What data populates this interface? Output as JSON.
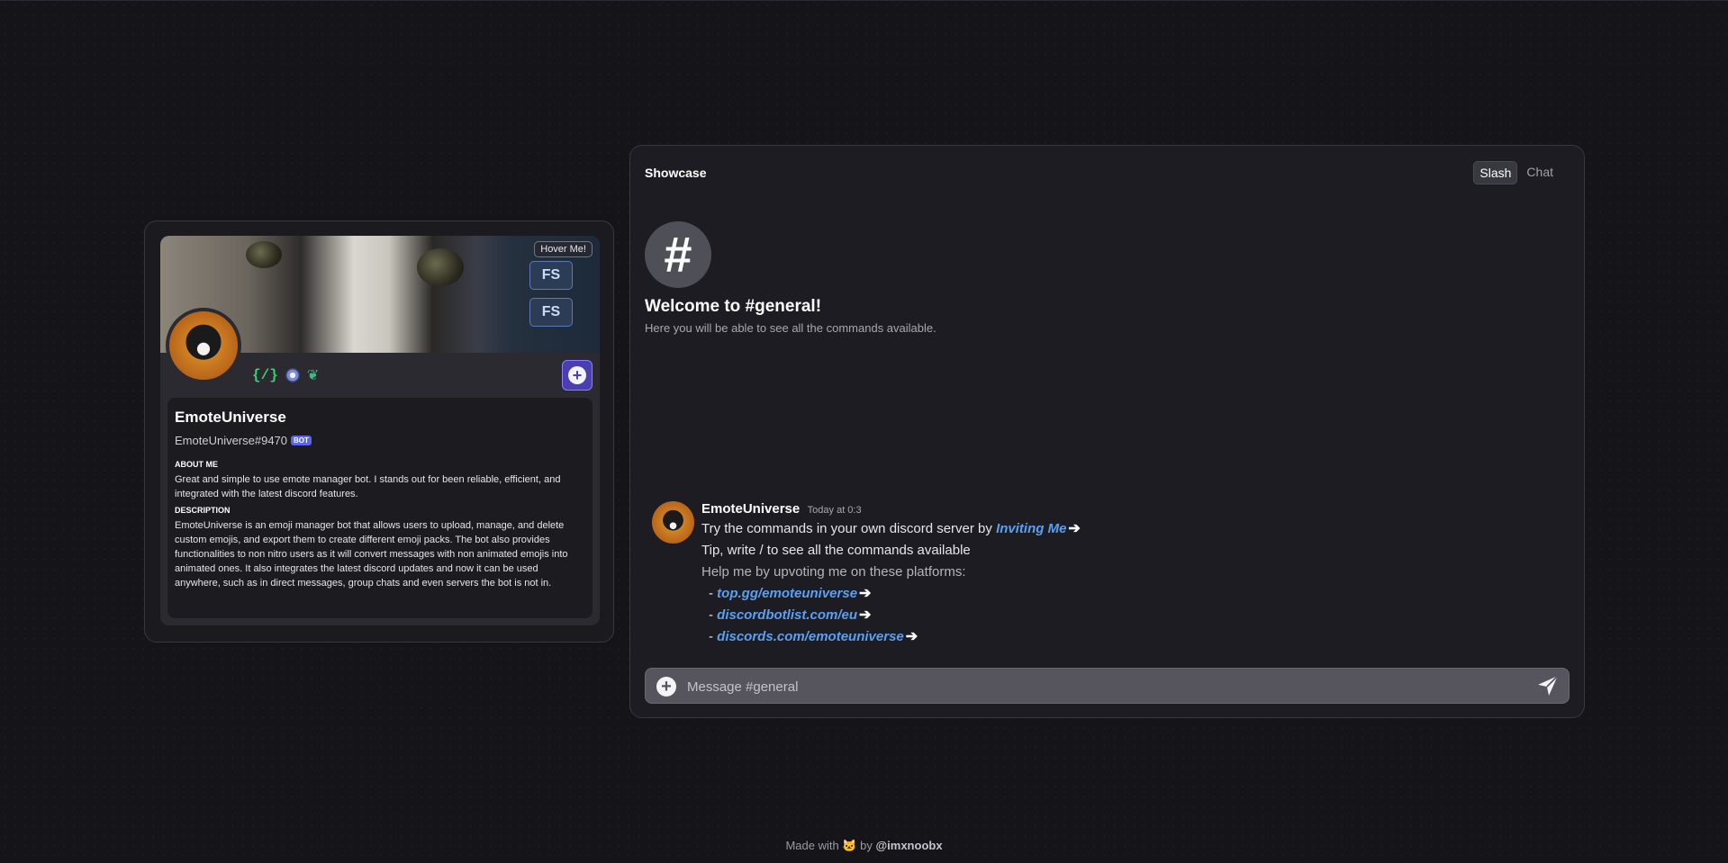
{
  "profile": {
    "hover_badge": "Hover Me!",
    "banner_keys": [
      "FS",
      "FS"
    ],
    "name": "EmoteUniverse",
    "tag": "EmoteUniverse#9470",
    "bot_label": "BOT",
    "badges": {
      "slash": "{/}"
    },
    "add_label": "+",
    "about_title": "ABOUT ME",
    "about_text": "Great and simple to use emote manager bot. I stands out for been reliable, efficient, and integrated with the latest discord features.",
    "description_title": "DESCRIPTION",
    "description_text": "EmoteUniverse is an emoji manager bot that allows users to upload, manage, and delete custom emojis, and export them to create different emoji packs. The bot also provides functionalities to non nitro users as it will convert messages with non animated emojis into animated ones. It also integrates the latest discord updates and now it can be used anywhere, such as in direct messages, group chats and even servers the bot is not in."
  },
  "showcase": {
    "title": "Showcase",
    "tabs": [
      {
        "label": "Slash",
        "active": true
      },
      {
        "label": "Chat",
        "active": false
      }
    ],
    "hash_symbol": "#",
    "welcome_title": "Welcome to #general!",
    "welcome_sub": "Here you will be able to see all the commands available.",
    "message": {
      "author": "EmoteUniverse",
      "time": "Today at 0:3",
      "line1_prefix": "Try the commands in your own discord server by",
      "line1_link": "Inviting Me",
      "line2": "Tip, write / to see all the commands available",
      "line3": "Help me by upvoting me on these platforms:",
      "bullet_prefix": "-",
      "platforms": [
        "top.gg/emoteuniverse",
        "discordbotlist.com/eu",
        "discords.com/emoteuniverse"
      ],
      "arrow": "➔"
    },
    "composer": {
      "add_label": "+",
      "placeholder": "Message #general"
    }
  },
  "footer": {
    "made_with": "Made with",
    "by": "by",
    "author": "@imxnoobx"
  },
  "colors": {
    "background": "#151419",
    "panel": "#1d1c22",
    "link": "#5aa0f2",
    "bot_tag": "#5865f2",
    "add_button": "#4b3fb0"
  },
  "icons": [
    "slash-commands-badge-icon",
    "orb-badge-icon",
    "leaf-badge-icon",
    "add-friend-icon",
    "hash-icon",
    "add-attachment-icon",
    "send-icon",
    "arrow-right-icon",
    "cat-emoji-icon"
  ]
}
